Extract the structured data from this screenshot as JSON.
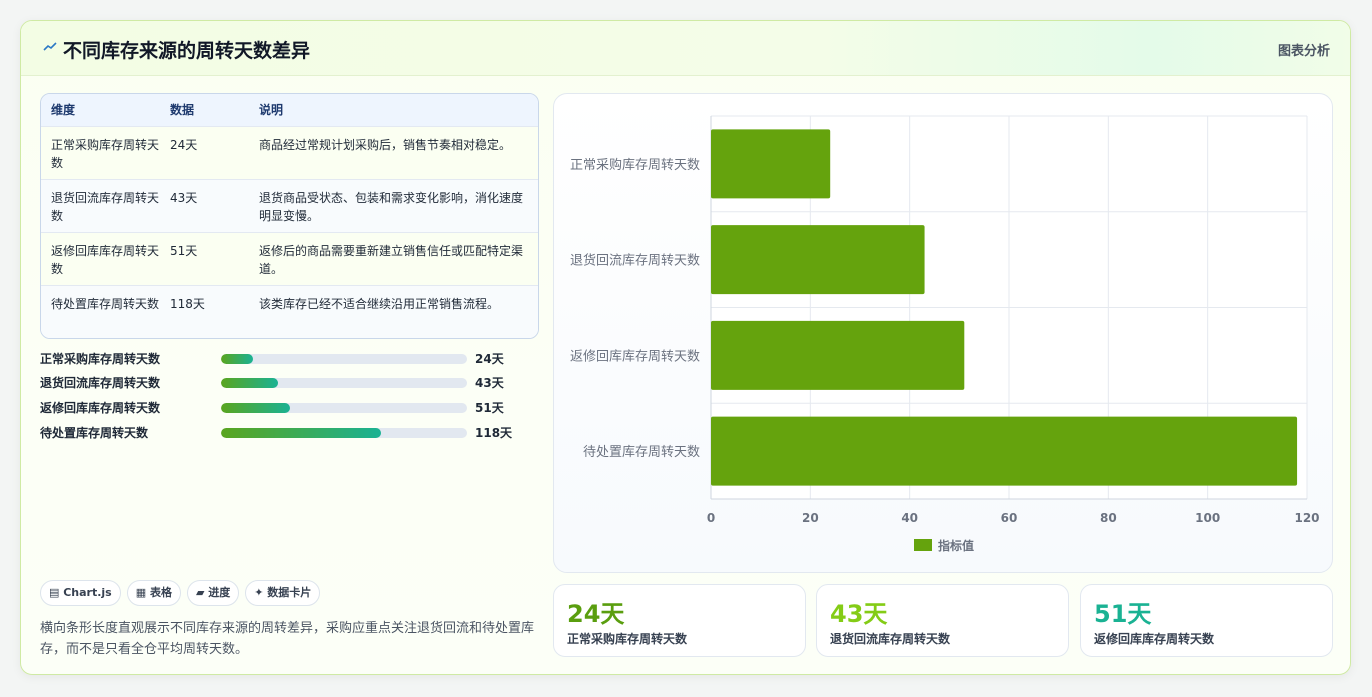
{
  "header": {
    "title": "不同库存来源的周转天数差异",
    "tag": "图表分析"
  },
  "table": {
    "headers": [
      "维度",
      "数据",
      "说明"
    ],
    "rows": [
      {
        "dim": "正常采购库存周转天数",
        "val": "24天",
        "desc": "商品经过常规计划采购后，销售节奏相对稳定。"
      },
      {
        "dim": "退货回流库存周转天数",
        "val": "43天",
        "desc": "退货商品受状态、包装和需求变化影响，消化速度明显变慢。"
      },
      {
        "dim": "返修回库库存周转天数",
        "val": "51天",
        "desc": "返修后的商品需要重新建立销售信任或匹配特定渠道。"
      },
      {
        "dim": "待处置库存周转天数",
        "val": "118天",
        "desc": "该类库存已经不适合继续沿用正常销售流程。"
      }
    ]
  },
  "progress": [
    {
      "label": "正常采购库存周转天数",
      "value": "24天",
      "fraction": 0.13
    },
    {
      "label": "退货回流库存周转天数",
      "value": "43天",
      "fraction": 0.23
    },
    {
      "label": "返修回库库存周转天数",
      "value": "51天",
      "fraction": 0.28
    },
    {
      "label": "待处置库存周转天数",
      "value": "118天",
      "fraction": 0.65
    }
  ],
  "chips": [
    "▤ Chart.js",
    "▦ 表格",
    "▰ 进度",
    "✦ 数据卡片"
  ],
  "note": "横向条形长度直观展示不同库存来源的周转差异，采购应重点关注退货回流和待处置库存，而不是只看全仓平均周转天数。",
  "stats": [
    {
      "value": "24天",
      "label": "正常采购库存周转天数",
      "color": "#5a9e0f"
    },
    {
      "value": "43天",
      "label": "退货回流库存周转天数",
      "color": "#84cc16"
    },
    {
      "value": "51天",
      "label": "返修回库库存周转天数",
      "color": "#1ab293"
    }
  ],
  "colors": {
    "bar": "#65a30d",
    "accent": "#5aa51e",
    "teal": "#1ab293"
  },
  "chart_data": {
    "type": "bar",
    "orientation": "horizontal",
    "categories": [
      "正常采购库存周转天数",
      "退货回流库存周转天数",
      "返修回库库存周转天数",
      "待处置库存周转天数"
    ],
    "series": [
      {
        "name": "指标值",
        "values": [
          24,
          43,
          51,
          118
        ]
      }
    ],
    "xlim": [
      0,
      120
    ],
    "xticks": [
      "0",
      "20",
      "40",
      "60",
      "80",
      "100",
      "120"
    ],
    "legend": "bottom",
    "grid": true
  }
}
